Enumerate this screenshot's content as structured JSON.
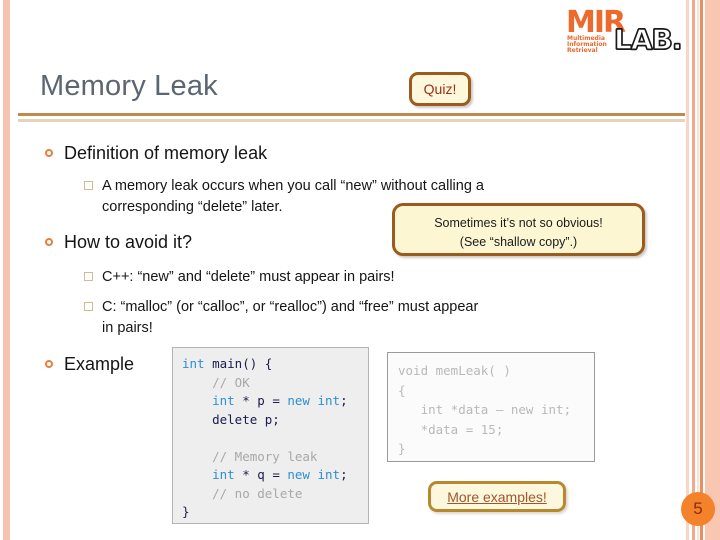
{
  "logo": {
    "mark": "MIR",
    "subtitle": "Multimedia\nInformation\nRetrieval",
    "wordmark": "LAB."
  },
  "header": {
    "title": "Memory Leak",
    "quiz_label": "Quiz!"
  },
  "bullets": {
    "definition_heading": "Definition of memory leak",
    "definition_text": "A memory leak occurs when you call “new” without calling a",
    "definition_text_cont": "corresponding “delete” later.",
    "avoid_heading": "How to avoid it?",
    "avoid_cpp": "C++: “new” and “delete” must appear in pairs!",
    "avoid_c": "C: “malloc” (or “calloc”, or “realloc”) and “free” must appear",
    "avoid_c_cont": "in pairs!",
    "example_heading": "Example"
  },
  "callout": {
    "line1": "Sometimes it’s not so obvious!",
    "line2": "(See “shallow copy”.)"
  },
  "code_main": {
    "l1_kw": "int",
    "l1_rest": " main() {",
    "l2": "    // OK",
    "l3a": "    int",
    "l3b": " * p = ",
    "l3c": "new",
    "l3d": " int",
    "l3e": ";",
    "l4": "    delete p;",
    "l5": "",
    "l6": "    // Memory leak",
    "l7a": "    int",
    "l7b": " * q = ",
    "l7c": "new",
    "l7d": " int",
    "l7e": ";",
    "l8": "    // no delete",
    "l9": "}"
  },
  "code_secondary": {
    "text": "void memLeak( )\n{\n   int *data – new int;\n   *data = 15;\n}"
  },
  "footer": {
    "more_examples_label": "More examples!",
    "slide_number": "5"
  },
  "colors": {
    "accent_orange": "#ec6a2c",
    "title_gray": "#5b6670",
    "rule_dark": "#c08a4a",
    "rule_light": "#e6d3bb",
    "callout_bg": "#fcf6d2",
    "callout_border": "#9b5b1f",
    "slide_num_bg": "#f4822a"
  }
}
